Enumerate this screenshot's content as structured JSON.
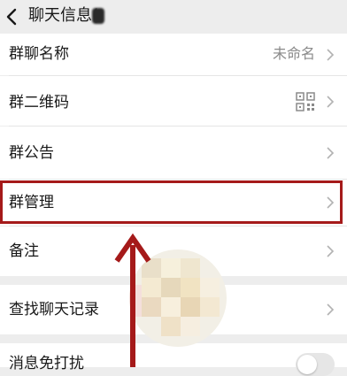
{
  "header": {
    "title": "聊天信息("
  },
  "rows": [
    {
      "label": "群聊名称",
      "value": "未命名"
    },
    {
      "label": "群二维码"
    },
    {
      "label": "群公告"
    },
    {
      "label": "群管理"
    },
    {
      "label": "备注"
    },
    {
      "label": "查找聊天记录"
    },
    {
      "label": "消息免打扰"
    }
  ],
  "icons": {
    "back": "chevron-left-icon",
    "chevron": "chevron-right-icon",
    "qr": "qr-code-icon"
  },
  "colors": {
    "highlight": "#a51a1a",
    "background": "#ededed",
    "row": "#ffffff"
  }
}
